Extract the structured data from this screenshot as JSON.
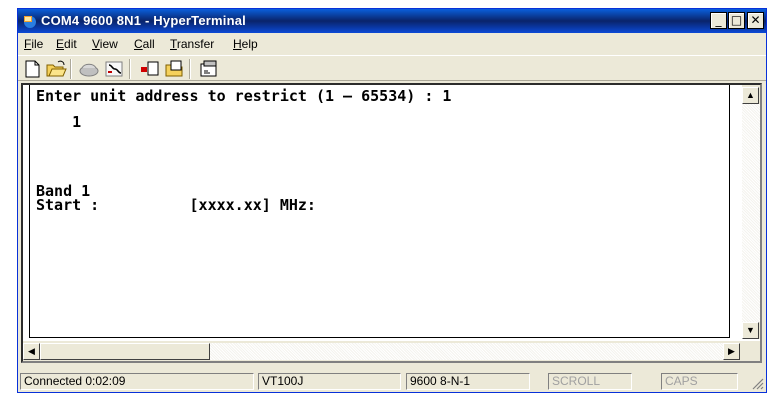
{
  "window": {
    "title": "COM4 9600 8N1 - HyperTerminal",
    "minimize": "_",
    "maximize": "□",
    "close": "✕"
  },
  "menu": [
    {
      "label": "File",
      "u": "F",
      "rest": "ile"
    },
    {
      "label": "Edit",
      "u": "E",
      "rest": "dit"
    },
    {
      "label": "View",
      "u": "V",
      "rest": "iew"
    },
    {
      "label": "Call",
      "u": "C",
      "rest": "all"
    },
    {
      "label": "Transfer",
      "u": "T",
      "rest": "ransfer"
    },
    {
      "label": "Help",
      "u": "H",
      "rest": "elp"
    }
  ],
  "toolbar": {
    "icons": [
      "new-icon",
      "open-icon",
      "disconnect-icon",
      "connect-icon",
      "send-icon",
      "receive-icon",
      "properties-icon"
    ]
  },
  "terminal": {
    "lines": [
      "Enter unit address to restrict (1 – 65534) : 1",
      "    1",
      "",
      "",
      "Band 1",
      "Start :          [xxxx.xx] MHz:"
    ]
  },
  "status": {
    "connected": "Connected 0:02:09",
    "emulation": "VT100J",
    "settings": "9600 8-N-1",
    "scroll": "SCROLL",
    "caps": "CAPS"
  },
  "colors": {
    "titlebar": "#0a246a",
    "chrome": "#ece9d8"
  }
}
